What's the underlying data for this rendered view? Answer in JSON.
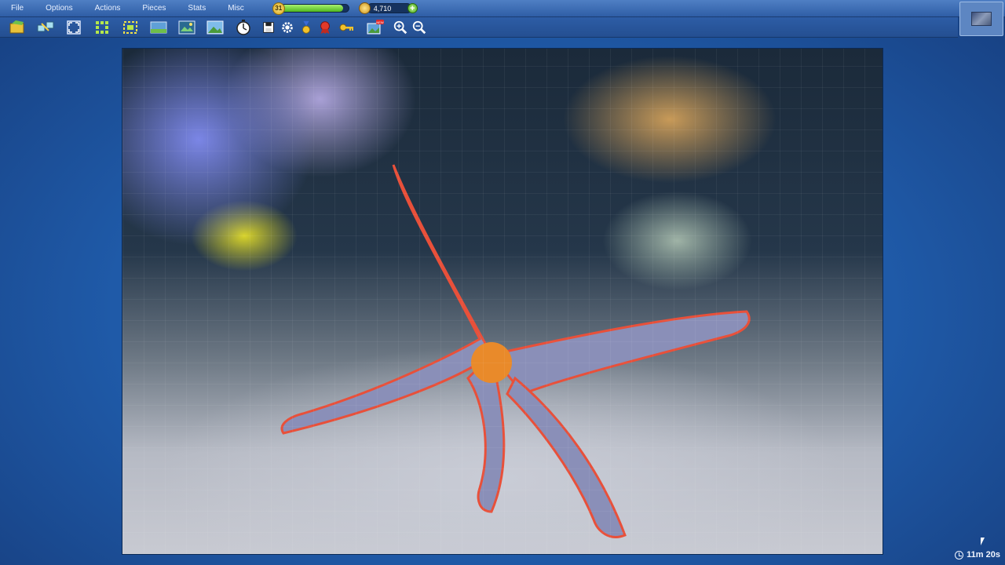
{
  "menu": {
    "items": [
      "File",
      "Options",
      "Actions",
      "Pieces",
      "Stats",
      "Misc"
    ]
  },
  "status": {
    "level": "31",
    "xp_progress_percent": 92,
    "coins": "4,710",
    "add_coins_glyph": "+"
  },
  "toolbar": {
    "buttons": [
      {
        "icon": "puzzle-box-icon"
      },
      {
        "icon": "scatter-pieces-icon"
      },
      {
        "icon": "fullscreen-icon"
      },
      {
        "icon": "sort-edges-icon"
      },
      {
        "icon": "select-edges-icon"
      },
      {
        "icon": "background-icon"
      },
      {
        "icon": "ghost-image-icon"
      },
      {
        "icon": "preview-image-icon"
      },
      {
        "icon": "timer-stopwatch-icon"
      },
      {
        "icon": "save-icon"
      },
      {
        "icon": "settings-gear-icon"
      },
      {
        "icon": "achievements-medal-icon"
      },
      {
        "icon": "awards-ribbon-icon"
      },
      {
        "icon": "hint-key-icon"
      },
      {
        "icon": "new-puzzle-icon",
        "badge": "NEW"
      },
      {
        "icon": "zoom-in-icon"
      },
      {
        "icon": "zoom-out-icon"
      }
    ]
  },
  "board": {
    "image_theme": "starfish-reef"
  },
  "timer": {
    "text": "11m 20s"
  },
  "colors": {
    "background": "#1f5aa8",
    "menubar": "#3a6ab2",
    "xp_fill": "#4fb81e",
    "coin": "#d6a21a"
  }
}
